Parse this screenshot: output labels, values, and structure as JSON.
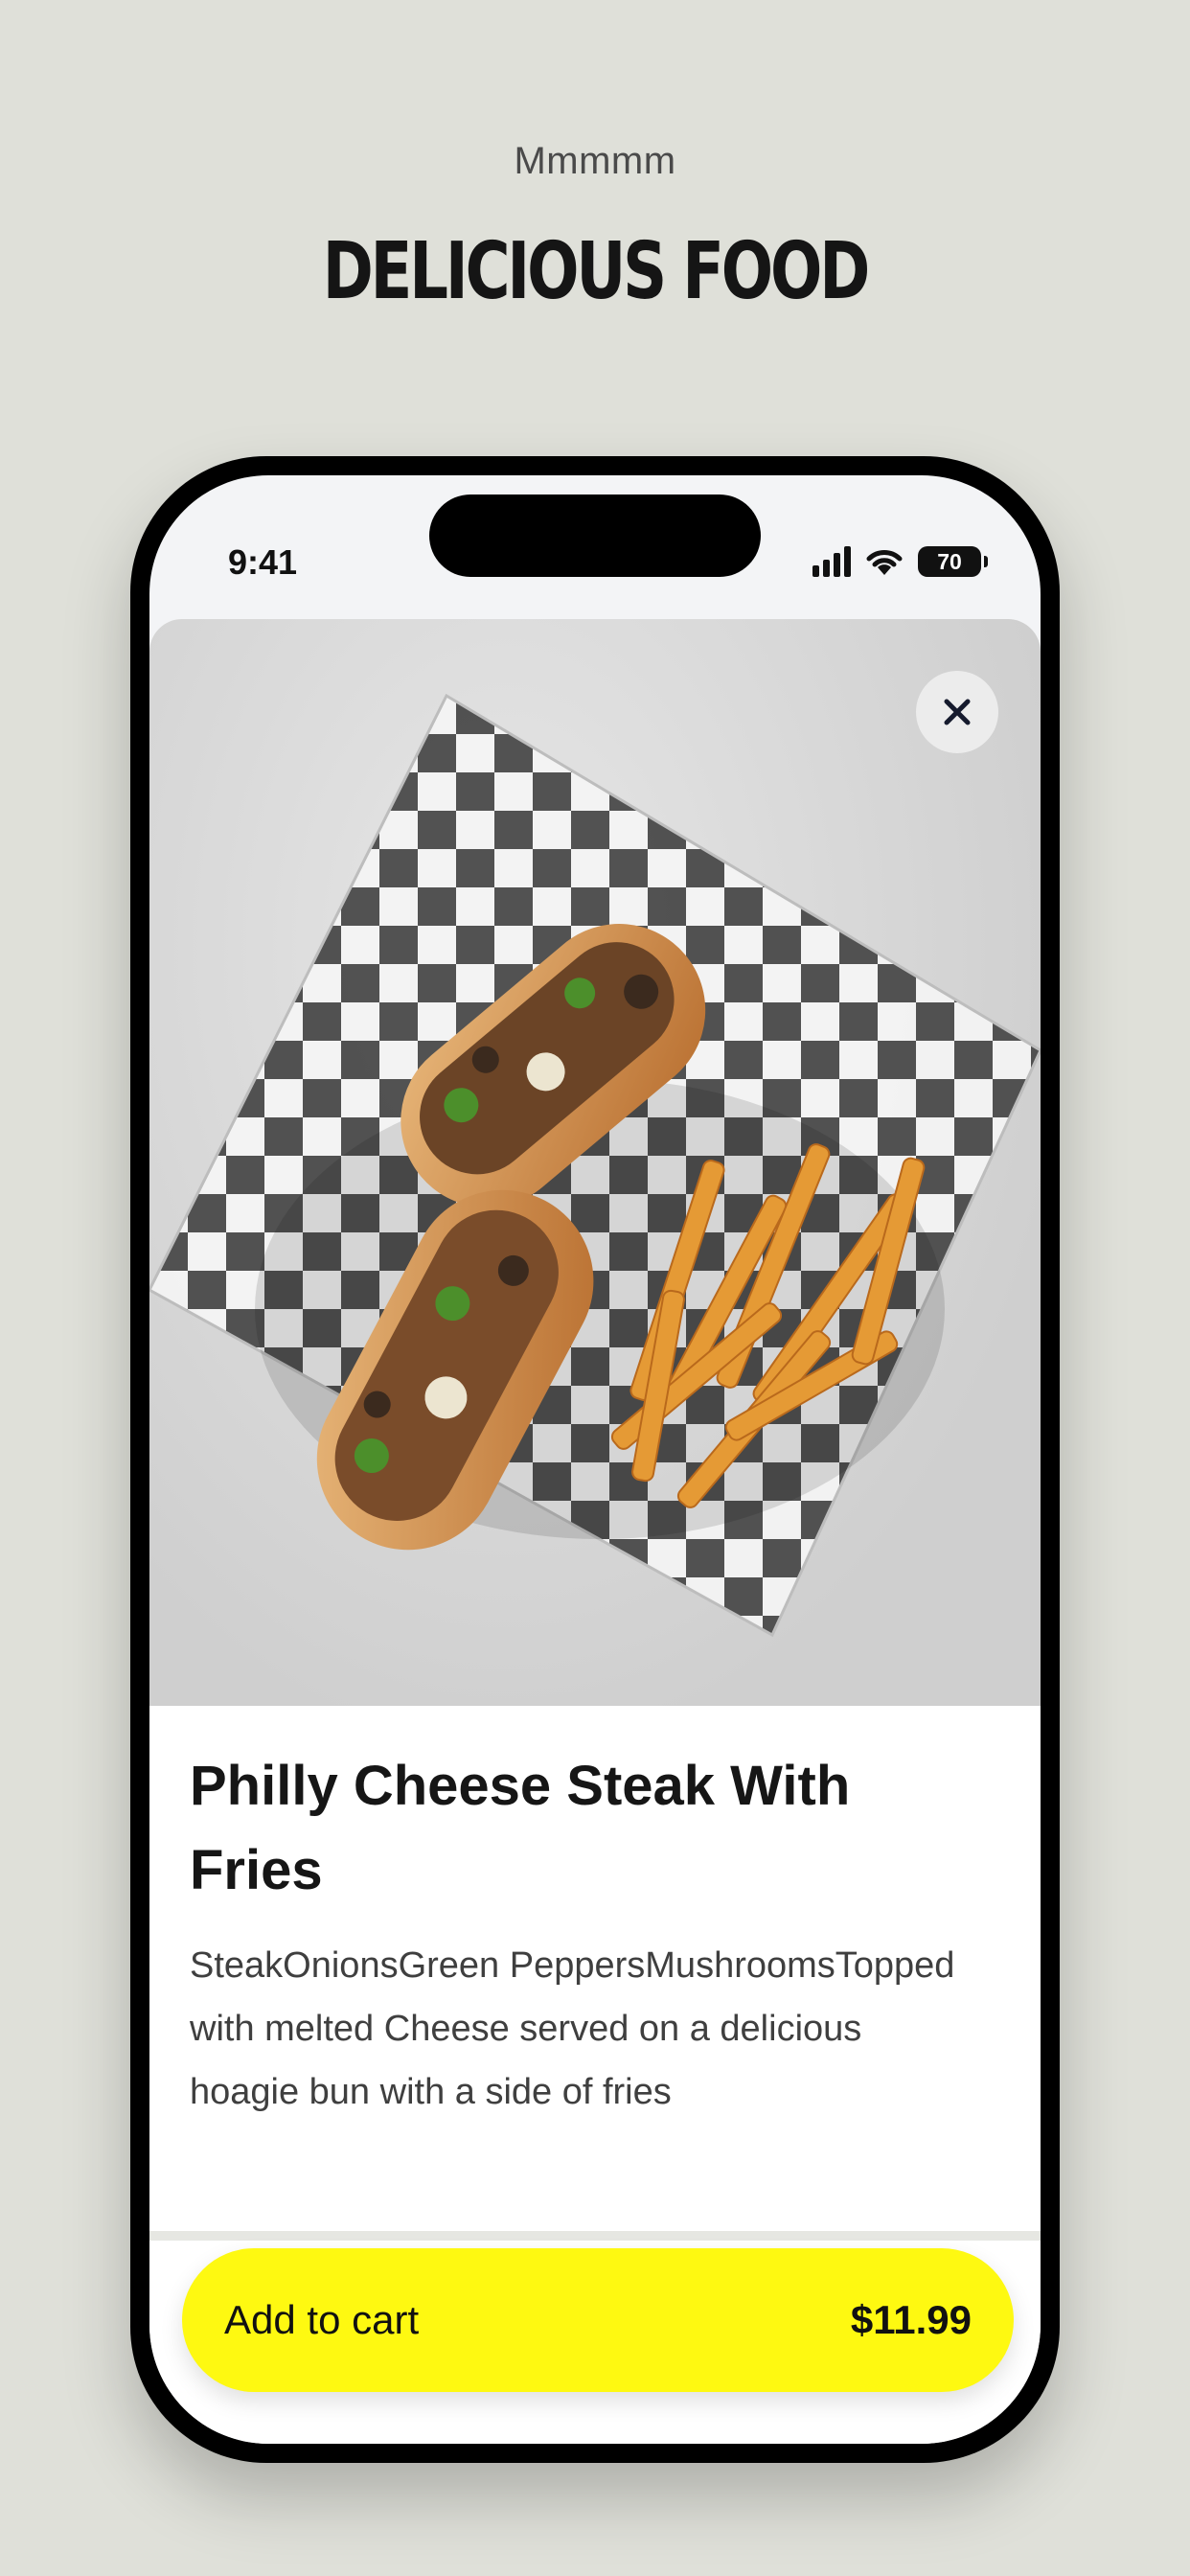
{
  "header": {
    "eyebrow": "Mmmmm",
    "title": "DELICIOUS FOOD"
  },
  "status_bar": {
    "time": "9:41",
    "battery": "70"
  },
  "item": {
    "image_alt": "Philly cheese steak sandwich with fries on checkered paper",
    "name": "Philly Cheese Steak With Fries",
    "description": "SteakOnionsGreen PeppersMushroomsTopped with melted Cheese served on a delicious hoagie bun with a side of fries"
  },
  "cart": {
    "label": "Add to cart",
    "price": "$11.99"
  },
  "icons": {
    "close": "close-icon",
    "signal": "cellular-signal-icon",
    "wifi": "wifi-icon",
    "battery": "battery-icon"
  },
  "colors": {
    "page_background": "#dfe0d9",
    "cart_button": "#fef911",
    "text": "#161616"
  }
}
